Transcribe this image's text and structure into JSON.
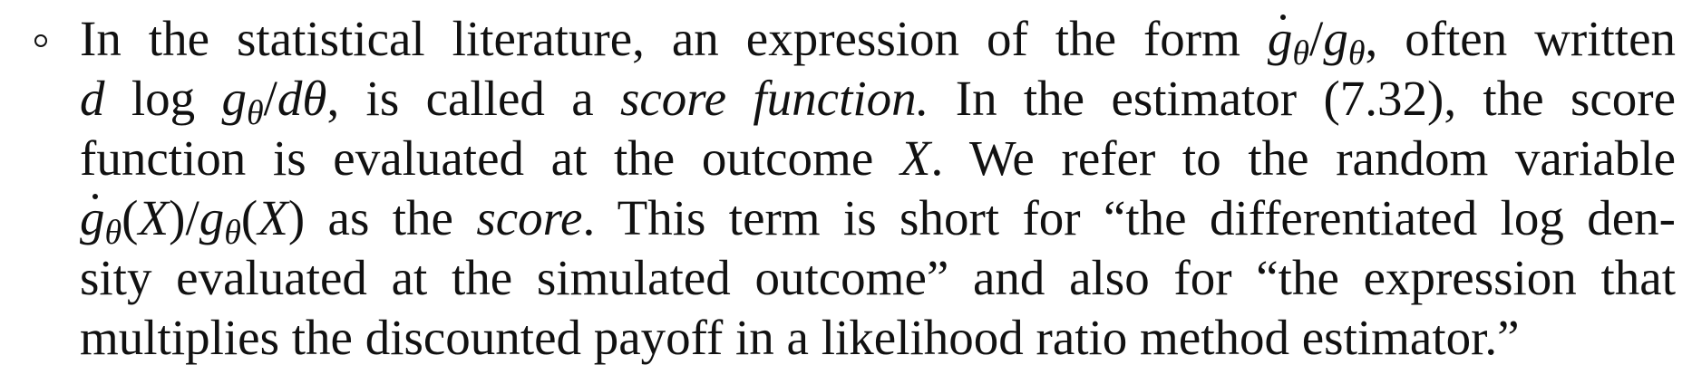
{
  "paragraph": {
    "line1": {
      "pre": "In the statistical literature, an expression of the form ",
      "g": "g",
      "theta": "θ",
      "slash": "/",
      "post": ", often written"
    },
    "line2": {
      "d1": "d",
      "log": "log",
      "g": "g",
      "theta": "θ",
      "slash": "/",
      "d2": "d",
      "theta2": "θ",
      "mid": ", is called a ",
      "emph": "score function.",
      "post": " In the estimator (7.32), the score"
    },
    "line3": {
      "pre": "function is evaluated at the outcome ",
      "X": "X",
      "post": ". We refer to the random variable"
    },
    "line4": {
      "g": "g",
      "theta": "θ",
      "open": "(",
      "X": "X",
      "close": ")",
      "slash": "/",
      "post1": " as the ",
      "emph": "score",
      "post2": ". This term is short for “the differentiated log den-"
    },
    "line5": {
      "text": "sity evaluated at the simulated outcome” and also for “the expression that"
    },
    "line6": {
      "text": "multiplies the discounted payoff in a likelihood ratio method estimator.”"
    }
  }
}
